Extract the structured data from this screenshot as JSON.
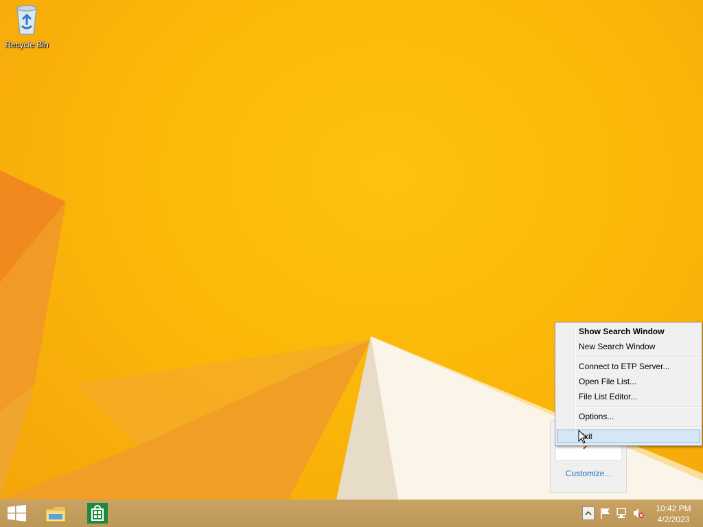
{
  "desktop": {
    "icons": [
      {
        "label": "Recycle Bin",
        "icon": "recycle-bin-icon"
      }
    ]
  },
  "context_menu": {
    "items": [
      {
        "label": "Show Search Window",
        "bold": true
      },
      {
        "label": "New Search Window"
      },
      {
        "label": "Connect to ETP Server..."
      },
      {
        "label": "Open File List..."
      },
      {
        "label": "File List Editor..."
      },
      {
        "label": "Options..."
      },
      {
        "label": "Exit",
        "hovered": true
      }
    ]
  },
  "tray_flyout": {
    "customize_label": "Customize..."
  },
  "taskbar": {
    "pinned": [
      {
        "name": "start-button",
        "icon": "windows-logo-icon"
      },
      {
        "name": "file-explorer-button",
        "icon": "folder-icon"
      },
      {
        "name": "store-button",
        "icon": "store-icon"
      }
    ],
    "tray_icons": [
      "show-hidden-icons-icon",
      "action-center-flag-icon",
      "network-icon",
      "volume-muted-icon"
    ],
    "clock": {
      "time": "10:42 PM",
      "date": "4/2/2023"
    }
  },
  "colors": {
    "wallpaper": "#fbb809",
    "taskbar": "#c29d5e",
    "menu_bg": "#f0f0f0",
    "menu_hover": "#d5e6f7",
    "link": "#1e6fbd"
  }
}
